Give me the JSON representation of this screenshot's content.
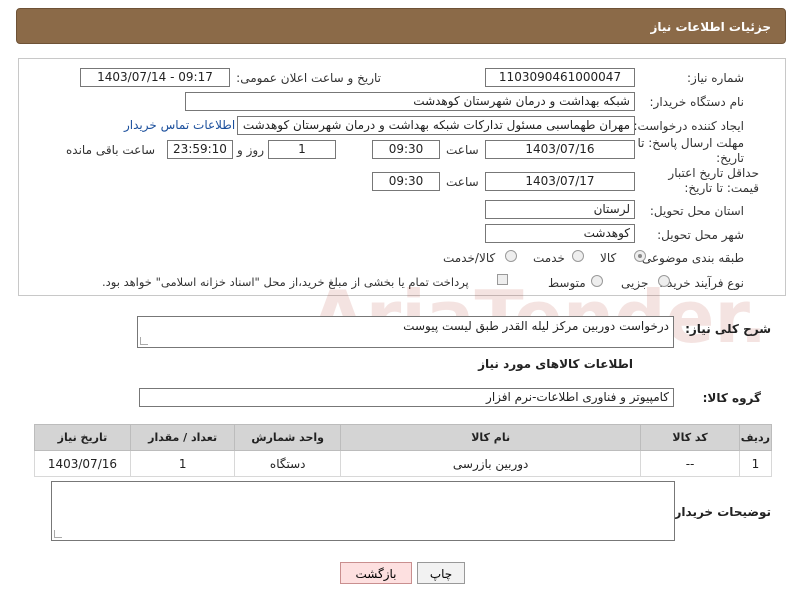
{
  "header": {
    "title": "جزئیات اطلاعات نیاز"
  },
  "fields": {
    "need_number_label": "شماره نیاز:",
    "need_number": "1103090461000047",
    "announce_label": "تاریخ و ساعت اعلان عمومی:",
    "announce_value": "1403/07/14 - 09:17",
    "buyer_org_label": "نام دستگاه خریدار:",
    "buyer_org": "شبکه بهداشت و درمان شهرستان کوهدشت",
    "creator_label": "ایجاد کننده درخواست:",
    "creator": "مهران طهماسبی مسئول تدارکات شبکه بهداشت و درمان شهرستان کوهدشت",
    "contact_link": "اطلاعات تماس خریدار",
    "deadline_label": "مهلت ارسال پاسخ: تا تاریخ:",
    "deadline_date": "1403/07/16",
    "time_label": "ساعت",
    "deadline_time": "09:30",
    "days_value": "1",
    "days_label": "روز و",
    "remaining_time": "23:59:10",
    "remaining_label": "ساعت باقی مانده",
    "validity_label": "حداقل تاریخ اعتبار قیمت: تا تاریخ:",
    "validity_date": "1403/07/17",
    "validity_time": "09:30",
    "province_label": "استان محل تحویل:",
    "province": "لرستان",
    "city_label": "شهر محل تحویل:",
    "city": "کوهدشت",
    "category_label": "طبقه بندی موضوعی:",
    "category_options": [
      "کالا",
      "خدمت",
      "کالا/خدمت"
    ],
    "process_label": "نوع فرآیند خرید :",
    "process_options": [
      "جزیی",
      "متوسط"
    ],
    "payment_note": "پرداخت تمام یا بخشی از مبلغ خرید،از محل \"اسناد خزانه اسلامی\" خواهد بود."
  },
  "description": {
    "label": "شرح کلی نیاز:",
    "value": "درخواست دوربین مرکز لیله القدر طبق لیست پیوست"
  },
  "goods": {
    "section_title": "اطلاعات کالاهای مورد نیاز",
    "group_label": "گروه کالا:",
    "group_value": "کامپیوتر و فناوری اطلاعات-نرم افزار",
    "columns": [
      "ردیف",
      "کد کالا",
      "نام کالا",
      "واحد شمارش",
      "تعداد / مقدار",
      "تاریخ نیاز"
    ],
    "rows": [
      {
        "row": "1",
        "code": "--",
        "name": "دوربین بازرسی",
        "unit": "دستگاه",
        "qty": "1",
        "date": "1403/07/16"
      }
    ]
  },
  "buyer_notes": {
    "label": "توضیحات خریدار:",
    "value": ""
  },
  "buttons": {
    "print": "چاپ",
    "back": "بازگشت"
  },
  "watermark": {
    "text": "AriaTender.net"
  },
  "colors": {
    "header_bg": "#8b6a48",
    "table_header": "#d4d4d4",
    "link": "#1b4f9c"
  }
}
